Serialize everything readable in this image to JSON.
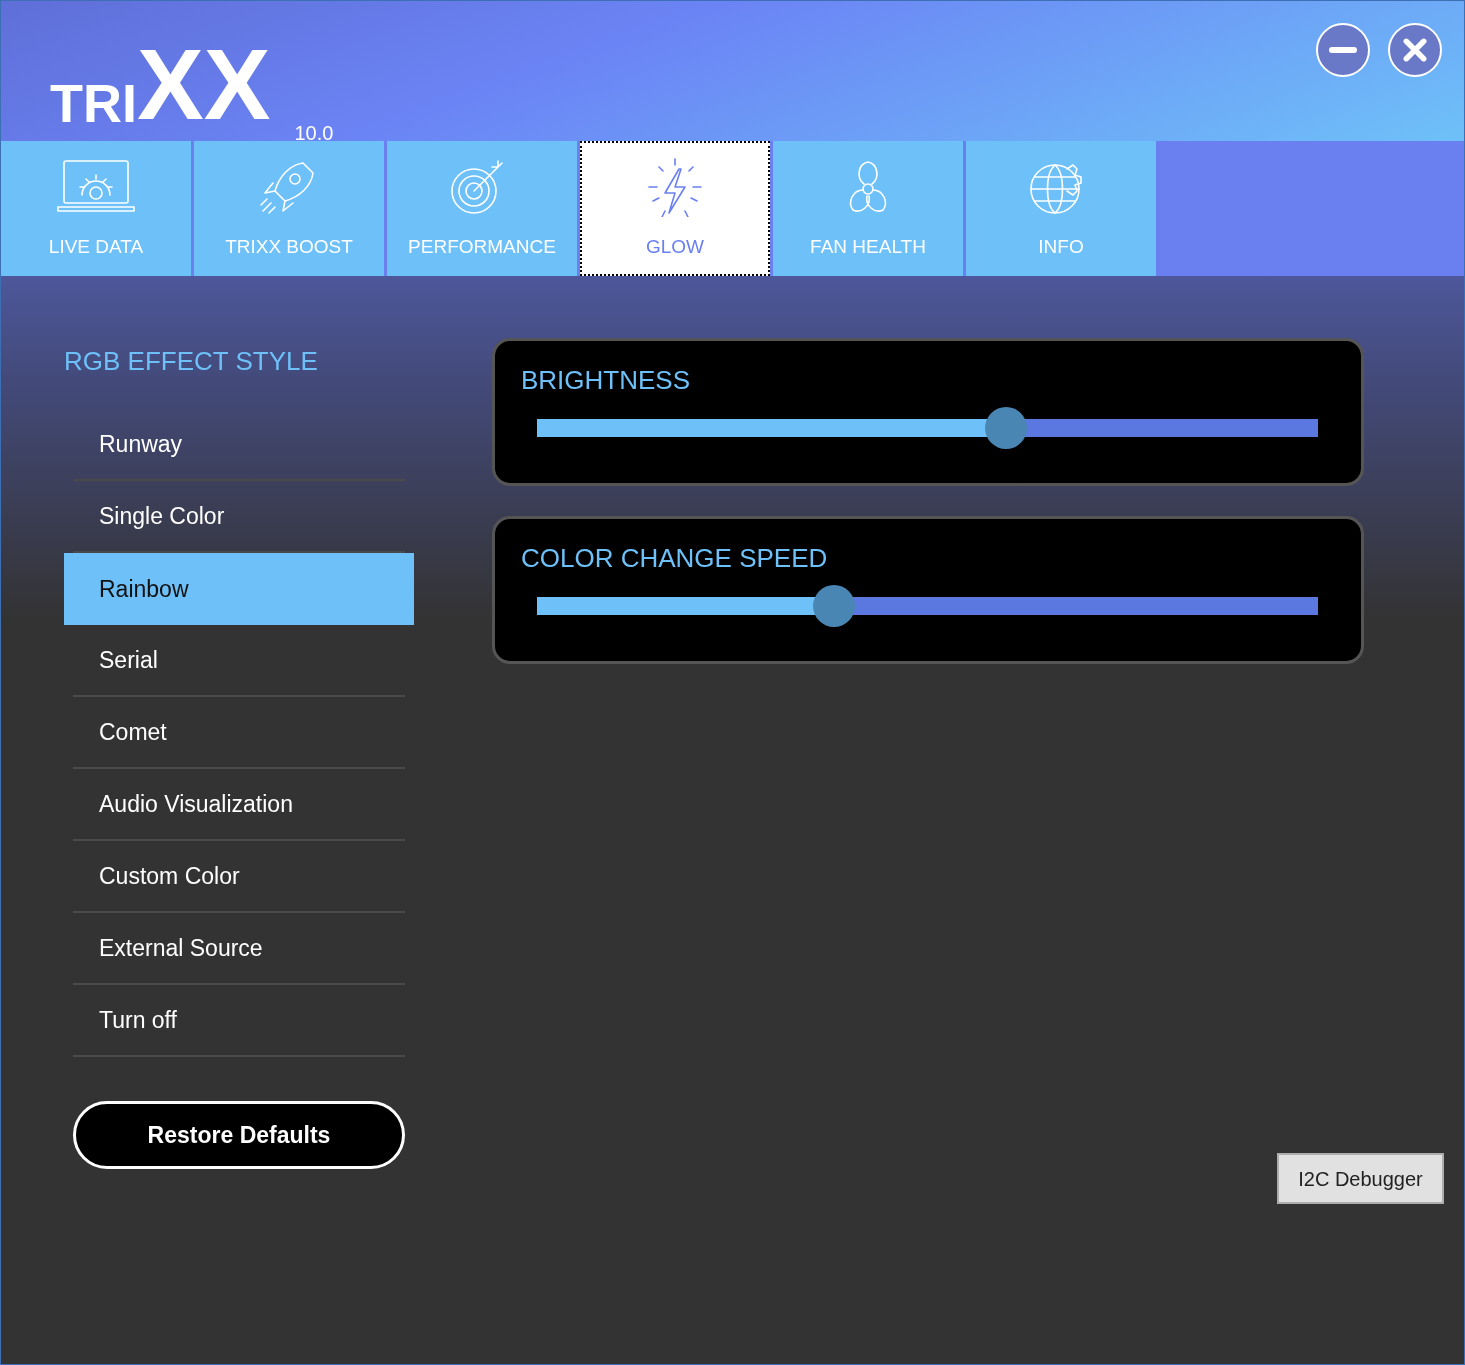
{
  "logo": {
    "prefix": "TRI",
    "mark": "XX"
  },
  "version": "10.0",
  "tabs": [
    {
      "label": "LIVE DATA",
      "selected": false
    },
    {
      "label": "TRIXX BOOST",
      "selected": false
    },
    {
      "label": "PERFORMANCE",
      "selected": false
    },
    {
      "label": "GLOW",
      "selected": true
    },
    {
      "label": "FAN HEALTH",
      "selected": false
    },
    {
      "label": "INFO",
      "selected": false
    }
  ],
  "effects": {
    "title": "RGB EFFECT STYLE",
    "items": [
      {
        "label": "Runway",
        "selected": false
      },
      {
        "label": "Single Color",
        "selected": false
      },
      {
        "label": "Rainbow",
        "selected": true
      },
      {
        "label": "Serial",
        "selected": false
      },
      {
        "label": "Comet",
        "selected": false
      },
      {
        "label": "Audio Visualization",
        "selected": false
      },
      {
        "label": "Custom Color",
        "selected": false
      },
      {
        "label": "External Source",
        "selected": false
      },
      {
        "label": "Turn off",
        "selected": false
      }
    ]
  },
  "restore_button": "Restore Defaults",
  "sliders": [
    {
      "label": "BRIGHTNESS",
      "level": 0.6
    },
    {
      "label": "COLOR CHANGE SPEED",
      "level": 0.38
    }
  ],
  "debug_button": "I2C Debugger"
}
